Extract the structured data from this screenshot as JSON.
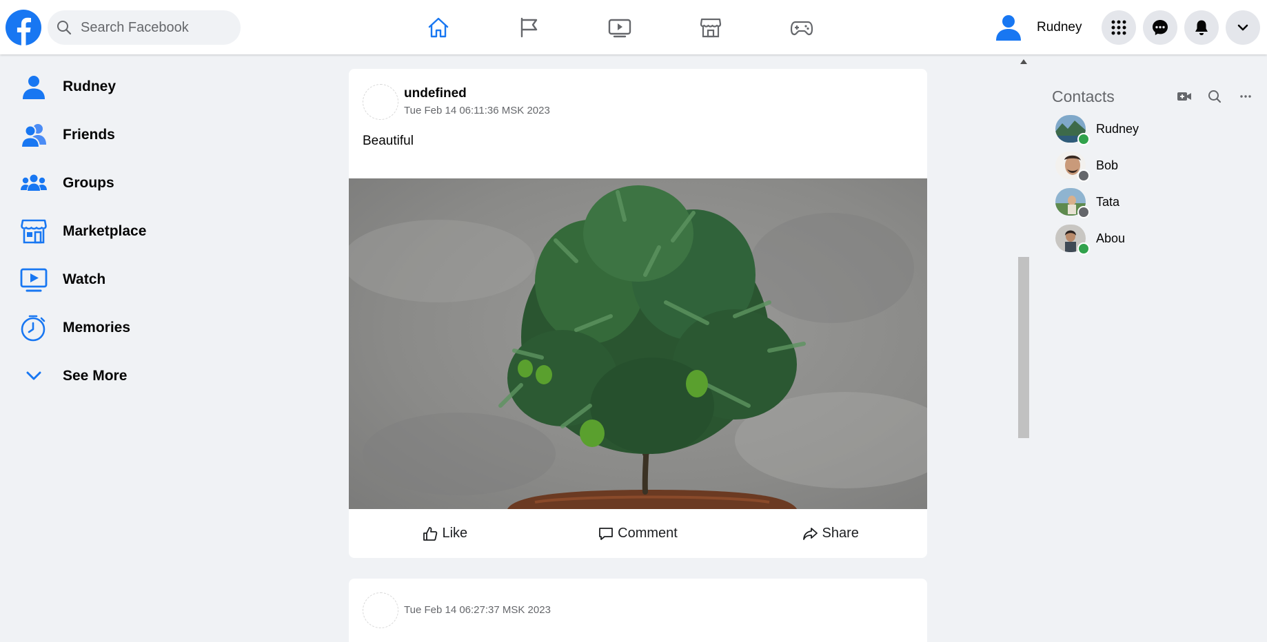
{
  "colors": {
    "brand_blue": "#1877f2",
    "online": "#31a24c",
    "offline": "#65676b",
    "background": "#f0f2f5"
  },
  "header": {
    "search_placeholder": "Search Facebook",
    "nav_icons": [
      "home-icon",
      "flag-icon",
      "watch-icon",
      "marketplace-icon",
      "gaming-icon"
    ],
    "active_nav": "home",
    "profile_name": "Rudney",
    "right_buttons": [
      "menu-grid-icon",
      "messenger-icon",
      "notifications-icon",
      "account-chevron-icon"
    ]
  },
  "sidebar": {
    "items": [
      {
        "label": "Rudney",
        "icon": "user-icon"
      },
      {
        "label": "Friends",
        "icon": "friends-icon"
      },
      {
        "label": "Groups",
        "icon": "groups-icon"
      },
      {
        "label": "Marketplace",
        "icon": "marketplace-icon"
      },
      {
        "label": "Watch",
        "icon": "watch-icon"
      },
      {
        "label": "Memories",
        "icon": "memories-icon"
      },
      {
        "label": "See More",
        "icon": "chevron-down-icon"
      }
    ]
  },
  "feed": {
    "posts": [
      {
        "author": "undefined",
        "timestamp": "Tue Feb 14 06:11:36 MSK 2023",
        "text": "Beautiful",
        "actions": {
          "like": "Like",
          "comment": "Comment",
          "share": "Share"
        }
      },
      {
        "author": "",
        "timestamp": "Tue Feb 14 06:27:37 MSK 2023"
      }
    ]
  },
  "contacts": {
    "title": "Contacts",
    "list": [
      {
        "name": "Rudney",
        "status": "online"
      },
      {
        "name": "Bob",
        "status": "offline"
      },
      {
        "name": "Tata",
        "status": "offline"
      },
      {
        "name": "Abou",
        "status": "online"
      }
    ]
  }
}
